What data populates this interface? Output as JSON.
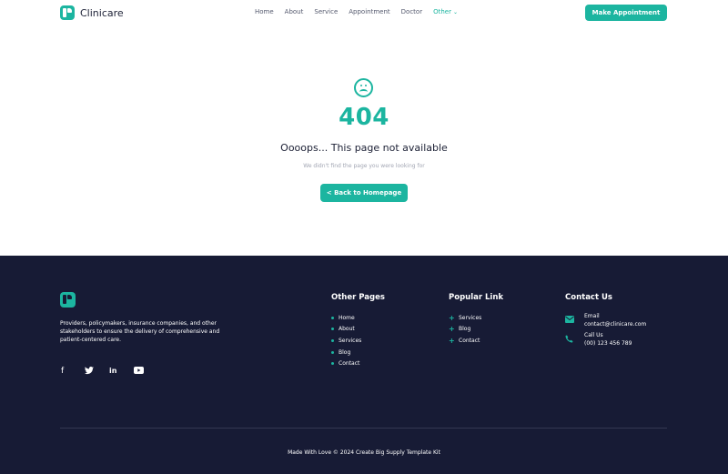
{
  "header": {
    "brand": "Clinicare",
    "nav": [
      {
        "label": "Home",
        "active": false
      },
      {
        "label": "About",
        "active": false
      },
      {
        "label": "Service",
        "active": false
      },
      {
        "label": "Appointment",
        "active": false
      },
      {
        "label": "Doctor",
        "active": false
      },
      {
        "label": "Other",
        "active": true
      }
    ],
    "cta_label": "Make Appointment"
  },
  "error": {
    "icon": "sad-face-icon",
    "code": "404",
    "title": "Oooops... This page not available",
    "subtitle": "We didn't find the page you were looking for",
    "back_label": "< Back to Homepage"
  },
  "footer": {
    "description": "Providers, policymakers, insurance companies, and other stakeholders to ensure the delivery of comprehensive and patient-centered care.",
    "social": [
      "facebook-icon",
      "twitter-icon",
      "linkedin-icon",
      "youtube-icon"
    ],
    "other_pages": {
      "heading": "Other Pages",
      "items": [
        "Home",
        "About",
        "Services",
        "Blog",
        "Contact"
      ]
    },
    "popular_links": {
      "heading": "Popular Link",
      "items": [
        "Services",
        "Blog",
        "Contact"
      ]
    },
    "contact": {
      "heading": "Contact Us",
      "email_label": "Email",
      "email": "contact@clinicare.com",
      "phone_label": "Call Us",
      "phone": "(00) 123 456 789"
    },
    "copyright": "Made With Love © 2024 Create Big Supply Template Kit"
  },
  "colors": {
    "accent": "#1cb5a0",
    "footer_bg": "#171b35",
    "text_dark": "#1c2035"
  }
}
